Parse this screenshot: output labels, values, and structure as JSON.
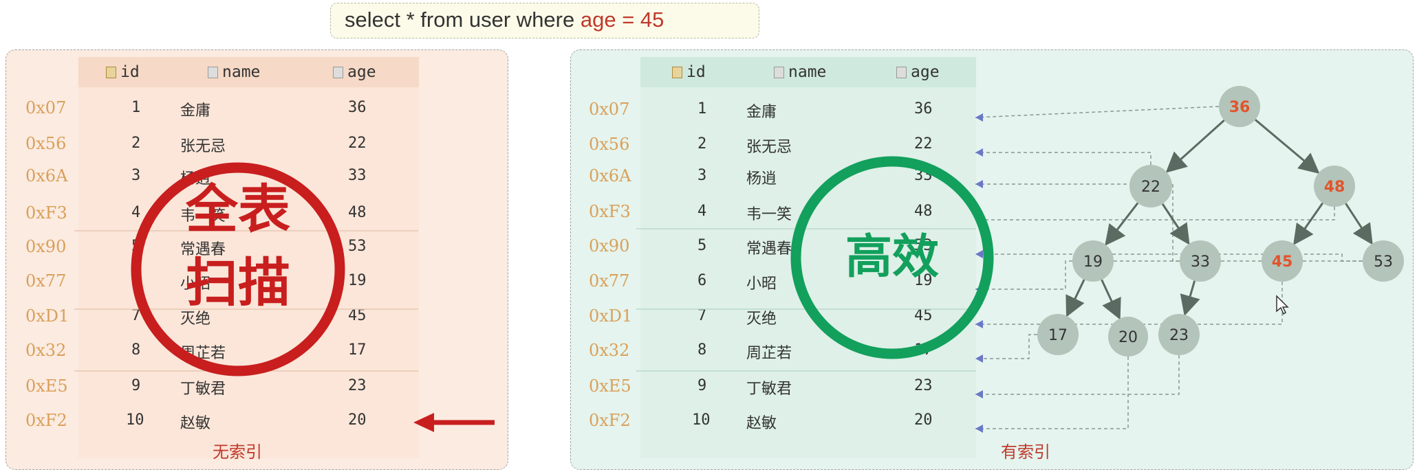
{
  "query": {
    "prefix": "select * from user where ",
    "highlight": "age = 45"
  },
  "table": {
    "columns": [
      "id",
      "name",
      "age"
    ],
    "rows": [
      {
        "addr": "0x07",
        "id": "1",
        "name": "金庸",
        "age": "36"
      },
      {
        "addr": "0x56",
        "id": "2",
        "name": "张无忌",
        "age": "22"
      },
      {
        "addr": "0x6A",
        "id": "3",
        "name": "杨逍",
        "age": "33"
      },
      {
        "addr": "0xF3",
        "id": "4",
        "name": "韦一笑",
        "age": "48"
      },
      {
        "addr": "0x90",
        "id": "5",
        "name": "常遇春",
        "age": "53"
      },
      {
        "addr": "0x77",
        "id": "6",
        "name": "小昭",
        "age": "19"
      },
      {
        "addr": "0xD1",
        "id": "7",
        "name": "灭绝",
        "age": "45"
      },
      {
        "addr": "0x32",
        "id": "8",
        "name": "周芷若",
        "age": "17"
      },
      {
        "addr": "0xE5",
        "id": "9",
        "name": "丁敏君",
        "age": "23"
      },
      {
        "addr": "0xF2",
        "id": "10",
        "name": "赵敏",
        "age": "20"
      }
    ]
  },
  "left_panel": {
    "caption": "无索引",
    "stamp_line1": "全表",
    "stamp_line2": "扫描"
  },
  "right_panel": {
    "caption": "有索引",
    "stamp": "高效"
  },
  "tree": {
    "nodes": [
      {
        "key": "36",
        "highlight": true
      },
      {
        "key": "22",
        "highlight": false
      },
      {
        "key": "48",
        "highlight": true
      },
      {
        "key": "19",
        "highlight": false
      },
      {
        "key": "33",
        "highlight": false
      },
      {
        "key": "45",
        "highlight": true
      },
      {
        "key": "53",
        "highlight": false
      },
      {
        "key": "17",
        "highlight": false
      },
      {
        "key": "20",
        "highlight": false
      },
      {
        "key": "23",
        "highlight": false
      }
    ]
  },
  "colors": {
    "left_bg": "#fbebe1",
    "right_bg": "#e5f4ee",
    "address": "#d9a05a",
    "red": "#c81e1e",
    "green": "#12a05c",
    "node_fill": "#b3c4ba",
    "node_highlight_text": "#e2542b"
  }
}
